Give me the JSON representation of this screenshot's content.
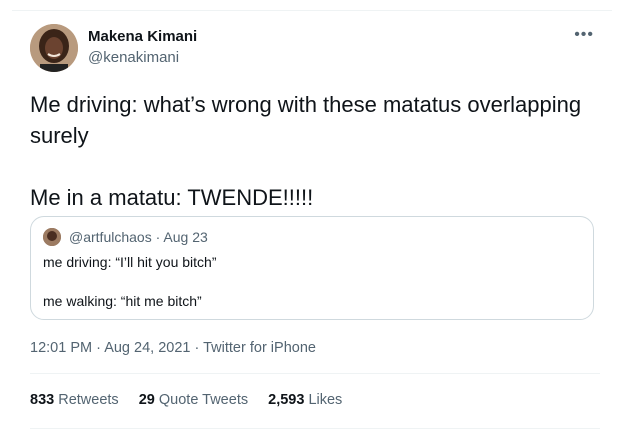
{
  "author": {
    "name": "Makena Kimani",
    "handle": "@kenakimani"
  },
  "more_icon": "more-horizontal-icon",
  "tweet_text": "Me driving: what’s wrong with these matatus overlapping surely\n\nMe in a matatu: TWENDE!!!!!",
  "quoted_tweet": {
    "handle": "@artfulchaos",
    "separator": "·",
    "date": "Aug 23",
    "line1": "me driving: “I’ll hit you bitch”",
    "line2": "me walking: “hit me bitch”"
  },
  "meta": {
    "time": "12:01 PM",
    "separator": "·",
    "date": "Aug 24, 2021",
    "source": "Twitter for iPhone"
  },
  "stats": [
    {
      "count": "833",
      "label": "Retweets"
    },
    {
      "count": "29",
      "label": "Quote Tweets"
    },
    {
      "count": "2,593",
      "label": "Likes"
    }
  ],
  "colors": {
    "text": "#0f1419",
    "secondary": "#536471",
    "border": "#cfd9de",
    "divider": "#eff3f4"
  }
}
